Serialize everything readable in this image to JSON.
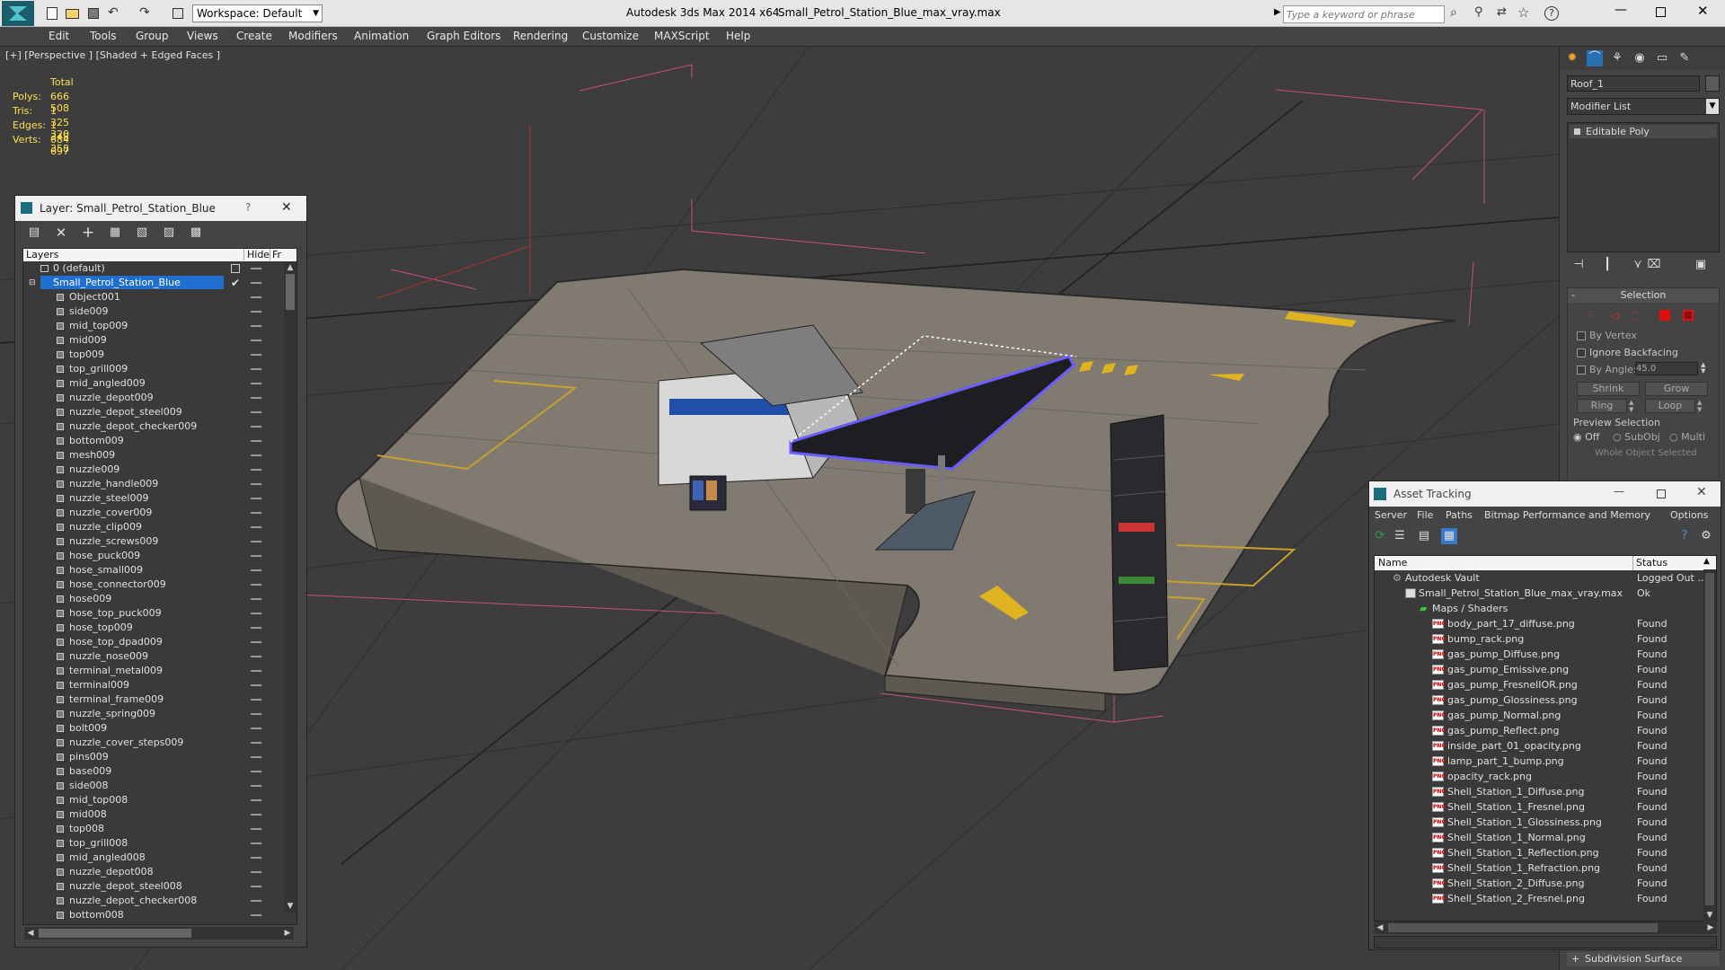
{
  "app": {
    "title": "Autodesk 3ds Max  2014 x64",
    "filename": "Small_Petrol_Station_Blue_max_vray.max",
    "workspace": "Workspace: Default",
    "search_placeholder": "Type a keyword or phrase"
  },
  "menu": [
    "Edit",
    "Tools",
    "Group",
    "Views",
    "Create",
    "Modifiers",
    "Animation",
    "Graph Editors",
    "Rendering",
    "Customize",
    "MAXScript",
    "Help"
  ],
  "viewport": {
    "label": "[+] [Perspective ] [Shaded + Edged Faces ]",
    "stats_header": "Total",
    "stats": [
      {
        "label": "Polys:",
        "value": "666 508"
      },
      {
        "label": "Tris:",
        "value": "1 325 320"
      },
      {
        "label": "Edges:",
        "value": "1 348 358"
      },
      {
        "label": "Verts:",
        "value": "684 697"
      }
    ]
  },
  "layer_window": {
    "title": "Layer: Small_Petrol_Station_Blue",
    "help": "?",
    "close": "✕",
    "col_layers": "Layers",
    "col_hide": "Hide",
    "col_fr": "Fr",
    "default_layer": "0 (default)",
    "active_layer": "Small_Petrol_Station_Blue",
    "objects": [
      "Object001",
      "side009",
      "mid_top009",
      "mid009",
      "top009",
      "top_grill009",
      "mid_angled009",
      "nuzzle_depot009",
      "nuzzle_depot_steel009",
      "nuzzle_depot_checker009",
      "bottom009",
      "mesh009",
      "nuzzle009",
      "nuzzle_handle009",
      "nuzzle_steel009",
      "nuzzle_cover009",
      "nuzzle_clip009",
      "nuzzle_screws009",
      "hose_puck009",
      "hose_small009",
      "hose_connector009",
      "hose009",
      "hose_top_puck009",
      "hose_top009",
      "hose_top_dpad009",
      "nuzzle_nose009",
      "terminal_metal009",
      "terminal009",
      "terminal_frame009",
      "nuzzle_spring009",
      "bolt009",
      "nuzzle_cover_steps009",
      "pins009",
      "base009",
      "side008",
      "mid_top008",
      "mid008",
      "top008",
      "top_grill008",
      "mid_angled008",
      "nuzzle_depot008",
      "nuzzle_depot_steel008",
      "nuzzle_depot_checker008",
      "bottom008"
    ]
  },
  "asset_window": {
    "title": "Asset Tracking",
    "menu": [
      "Server",
      "File",
      "Paths",
      "Bitmap Performance and Memory",
      "Options"
    ],
    "col_name": "Name",
    "col_status": "Status",
    "vault": {
      "name": "Autodesk Vault",
      "status": "Logged Out ..."
    },
    "file": {
      "name": "Small_Petrol_Station_Blue_max_vray.max",
      "status": "Ok"
    },
    "maps_group": "Maps / Shaders",
    "png_label": "PNG",
    "assets": [
      {
        "name": "body_part_17_diffuse.png",
        "status": "Found"
      },
      {
        "name": "bump_rack.png",
        "status": "Found"
      },
      {
        "name": "gas_pump_Diffuse.png",
        "status": "Found"
      },
      {
        "name": "gas_pump_Emissive.png",
        "status": "Found"
      },
      {
        "name": "gas_pump_FresnelIOR.png",
        "status": "Found"
      },
      {
        "name": "gas_pump_Glossiness.png",
        "status": "Found"
      },
      {
        "name": "gas_pump_Normal.png",
        "status": "Found"
      },
      {
        "name": "gas_pump_Reflect.png",
        "status": "Found"
      },
      {
        "name": "inside_part_01_opacity.png",
        "status": "Found"
      },
      {
        "name": "lamp_part_1_bump.png",
        "status": "Found"
      },
      {
        "name": "opacity_rack.png",
        "status": "Found"
      },
      {
        "name": "Shell_Station_1_Diffuse.png",
        "status": "Found"
      },
      {
        "name": "Shell_Station_1_Fresnel.png",
        "status": "Found"
      },
      {
        "name": "Shell_Station_1_Glossiness.png",
        "status": "Found"
      },
      {
        "name": "Shell_Station_1_Normal.png",
        "status": "Found"
      },
      {
        "name": "Shell_Station_1_Reflection.png",
        "status": "Found"
      },
      {
        "name": "Shell_Station_1_Refraction.png",
        "status": "Found"
      },
      {
        "name": "Shell_Station_2_Diffuse.png",
        "status": "Found"
      },
      {
        "name": "Shell_Station_2_Fresnel.png",
        "status": "Found"
      }
    ]
  },
  "command_panel": {
    "object_name": "Roof_1",
    "modifier_list": "Modifier List",
    "stack_item": "Editable Poly",
    "selection_title": "Selection",
    "by_vertex": "By Vertex",
    "ignore_backfacing": "Ignore Backfacing",
    "by_angle": "By Angle:",
    "angle_value": "45.0",
    "shrink": "Shrink",
    "grow": "Grow",
    "ring": "Ring",
    "loop": "Loop",
    "preview_selection": "Preview Selection",
    "preview_opts": [
      "Off",
      "SubObj",
      "Multi"
    ],
    "whole_object": "Whole Object Selected",
    "subdivision": "Subdivision Surface"
  }
}
